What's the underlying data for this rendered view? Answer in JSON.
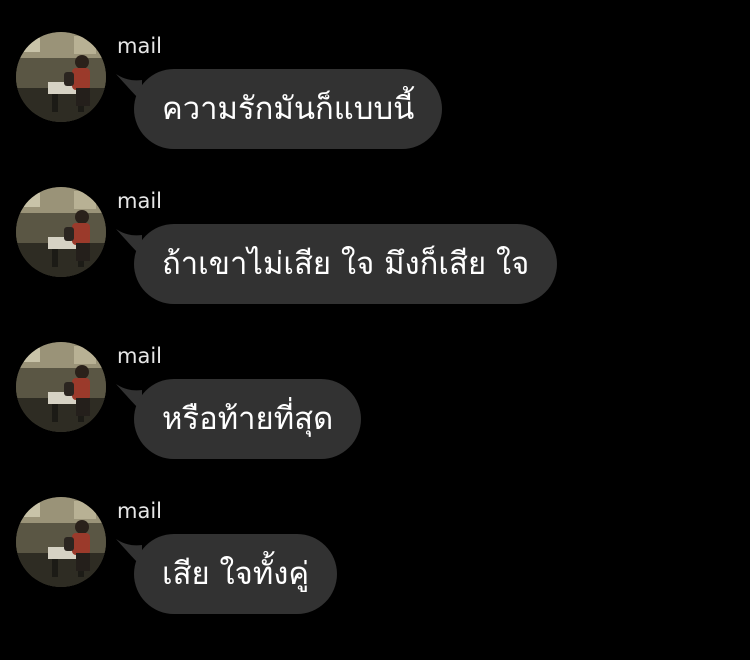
{
  "messages": [
    {
      "sender": "mail",
      "text": "ความรักมันก็แบบนี้"
    },
    {
      "sender": "mail",
      "text": "ถ้าเขาไม่เสีย ใจ มึงก็เสีย ใจ"
    },
    {
      "sender": "mail",
      "text": "หรือท้ายที่สุด"
    },
    {
      "sender": "mail",
      "text": "เสีย ใจทั้งคู่"
    }
  ],
  "colors": {
    "background": "#000000",
    "bubble": "#323232",
    "text": "#ffffff",
    "sender": "#e6e6e6"
  }
}
